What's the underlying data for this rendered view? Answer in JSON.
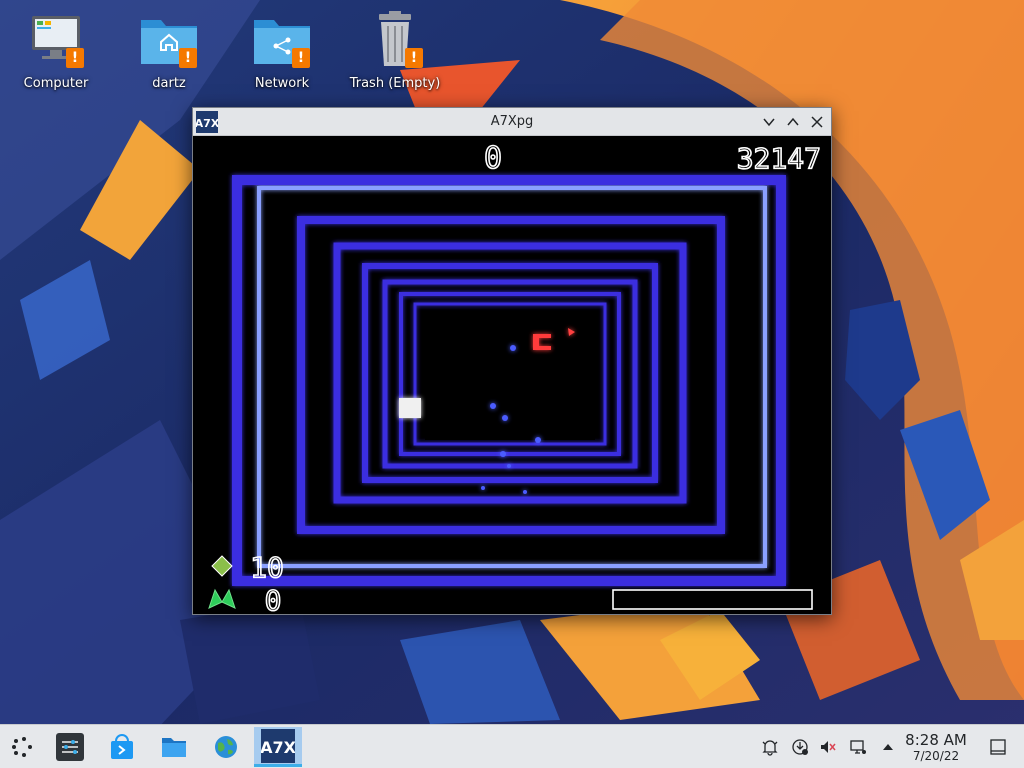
{
  "desktop": {
    "icons": [
      {
        "label": "Computer",
        "icon": "computer-icon",
        "badge": "!"
      },
      {
        "label": "dartz",
        "icon": "home-folder-icon",
        "badge": "!"
      },
      {
        "label": "Network",
        "icon": "network-folder-icon",
        "badge": "!"
      },
      {
        "label": "Trash (Empty)",
        "icon": "trash-icon",
        "badge": "!"
      }
    ]
  },
  "window": {
    "title": "A7Xpg",
    "app_icon_text": "A7X",
    "controls": [
      "minimize",
      "maximize",
      "close"
    ]
  },
  "game": {
    "score": "0",
    "hiscore": "32147",
    "level": "10",
    "lives": "0",
    "colors": {
      "tunnel": "#3a2fe0",
      "tunnel_inner": "#6a7cff",
      "enemy": "#ff3030",
      "ship": "#40c040"
    }
  },
  "taskbar": {
    "launcher_icons": [
      "application-launcher-icon",
      "system-settings-icon",
      "discover-store-icon",
      "file-manager-icon",
      "web-browser-icon",
      "a7xpg-icon"
    ],
    "active_app_text": "A7X",
    "tray_icons": [
      "notifications-icon",
      "updates-icon",
      "volume-muted-icon",
      "network-icon",
      "expand-tray-icon"
    ],
    "time": "8:28 AM",
    "date": "7/20/22",
    "show_desktop_icon": "show-desktop-icon"
  },
  "theme": {
    "accent": "#3daee9",
    "badge": "#f57900",
    "panel": "#e6e8eb"
  }
}
